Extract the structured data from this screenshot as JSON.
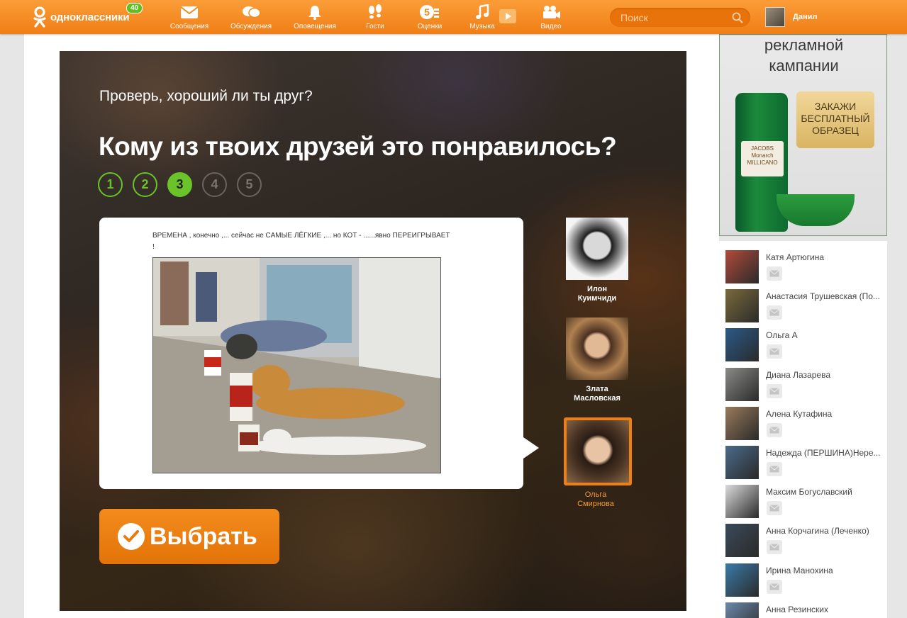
{
  "header": {
    "logo_text": "одноклассники",
    "logo_badge": "40",
    "nav": [
      {
        "label": "Сообщения",
        "icon": "envelope-icon"
      },
      {
        "label": "Обсуждения",
        "icon": "chat-bubbles-icon"
      },
      {
        "label": "Оповещения",
        "icon": "bell-icon"
      },
      {
        "label": "Гости",
        "icon": "footprints-icon"
      },
      {
        "label": "Оценки",
        "icon": "rating-icon"
      },
      {
        "label": "Музыка",
        "icon": "music-note-icon"
      },
      {
        "label": "Видео",
        "icon": "video-camera-icon"
      }
    ],
    "search_placeholder": "Поиск",
    "user_name": "Данил"
  },
  "quiz": {
    "subtitle": "Проверь, хороший ли ты друг?",
    "title": "Кому из твоих друзей это понравилось?",
    "steps": [
      "1",
      "2",
      "3",
      "4",
      "5"
    ],
    "current_step": 3,
    "post_text": "ВРЕМЕНА , конечно ,... сейчас не САМЫЕ ЛЁГКИЕ ,... но КОТ - ......явно ПЕРЕИГРЫВАЕТ !",
    "friends": [
      {
        "name_line1": "Илон",
        "name_line2": "Куимчиди",
        "selected": false
      },
      {
        "name_line1": "Злата",
        "name_line2": "Масловская",
        "selected": false
      },
      {
        "name_line1": "Ольга",
        "name_line2": "Смирнова",
        "selected": true
      }
    ],
    "choose_button": "Выбрать"
  },
  "ad": {
    "headline_line1": "рекламной",
    "headline_line2": "кампании",
    "cta_line1": "ЗАКАЖИ",
    "cta_line2": "БЕСПЛАТНЫЙ",
    "cta_line3": "ОБРАЗЕЦ",
    "brand_line1": "JACOBS",
    "brand_line2": "Monarch",
    "brand_line3": "MILLICANO"
  },
  "sidebar_friends": [
    {
      "name": "Катя Артюгина",
      "color": "#b24a3a"
    },
    {
      "name": "Анастасия Трушевская (По...",
      "color": "#7a6a3a"
    },
    {
      "name": "Ольга А",
      "color": "#2a5a8a"
    },
    {
      "name": "Диана Лазарева",
      "color": "#8a8a88"
    },
    {
      "name": "Алена Кутафина",
      "color": "#9a7a5a"
    },
    {
      "name": "Надежда (ПЕРШИНА)Нере...",
      "color": "#4a6a8a"
    },
    {
      "name": "Максим Богуславский",
      "color": "#dcdcdc"
    },
    {
      "name": "Анна Корчагина (Леченко)",
      "color": "#3a4a5a"
    },
    {
      "name": "Ирина Манохина",
      "color": "#3a7aaa"
    },
    {
      "name": "Анна Резинских",
      "color": "#6a8aaa"
    }
  ]
}
